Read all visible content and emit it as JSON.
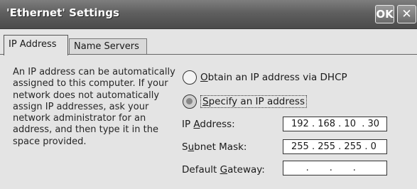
{
  "window": {
    "title": "'Ethernet' Settings",
    "ok_label": "OK",
    "close_glyph": "✕"
  },
  "tabs": [
    {
      "label": "IP Address",
      "active": true
    },
    {
      "label": "Name Servers",
      "active": false
    }
  ],
  "help_text": "An IP address can be automatically assigned to this computer.  If your network does not automatically assign IP addresses, ask your network administrator for an address, and then type it in the space provided.",
  "options": {
    "dhcp": {
      "prefix": "",
      "accel": "O",
      "rest": "btain an IP address via DHCP",
      "selected": false
    },
    "specify": {
      "prefix": "",
      "accel": "S",
      "rest": "pecify an IP address",
      "selected": true
    }
  },
  "fields": {
    "ip_address": {
      "prefix": "IP ",
      "accel": "A",
      "rest": "ddress:",
      "value": "192 . 168 . 10  . 30"
    },
    "subnet_mask": {
      "prefix": "S",
      "accel": "u",
      "rest": "bnet Mask:",
      "value": "255 . 255 . 255 . 0"
    },
    "default_gateway": {
      "prefix": "Default ",
      "accel": "G",
      "rest": "ateway:",
      "value": "     .       .       ."
    }
  }
}
